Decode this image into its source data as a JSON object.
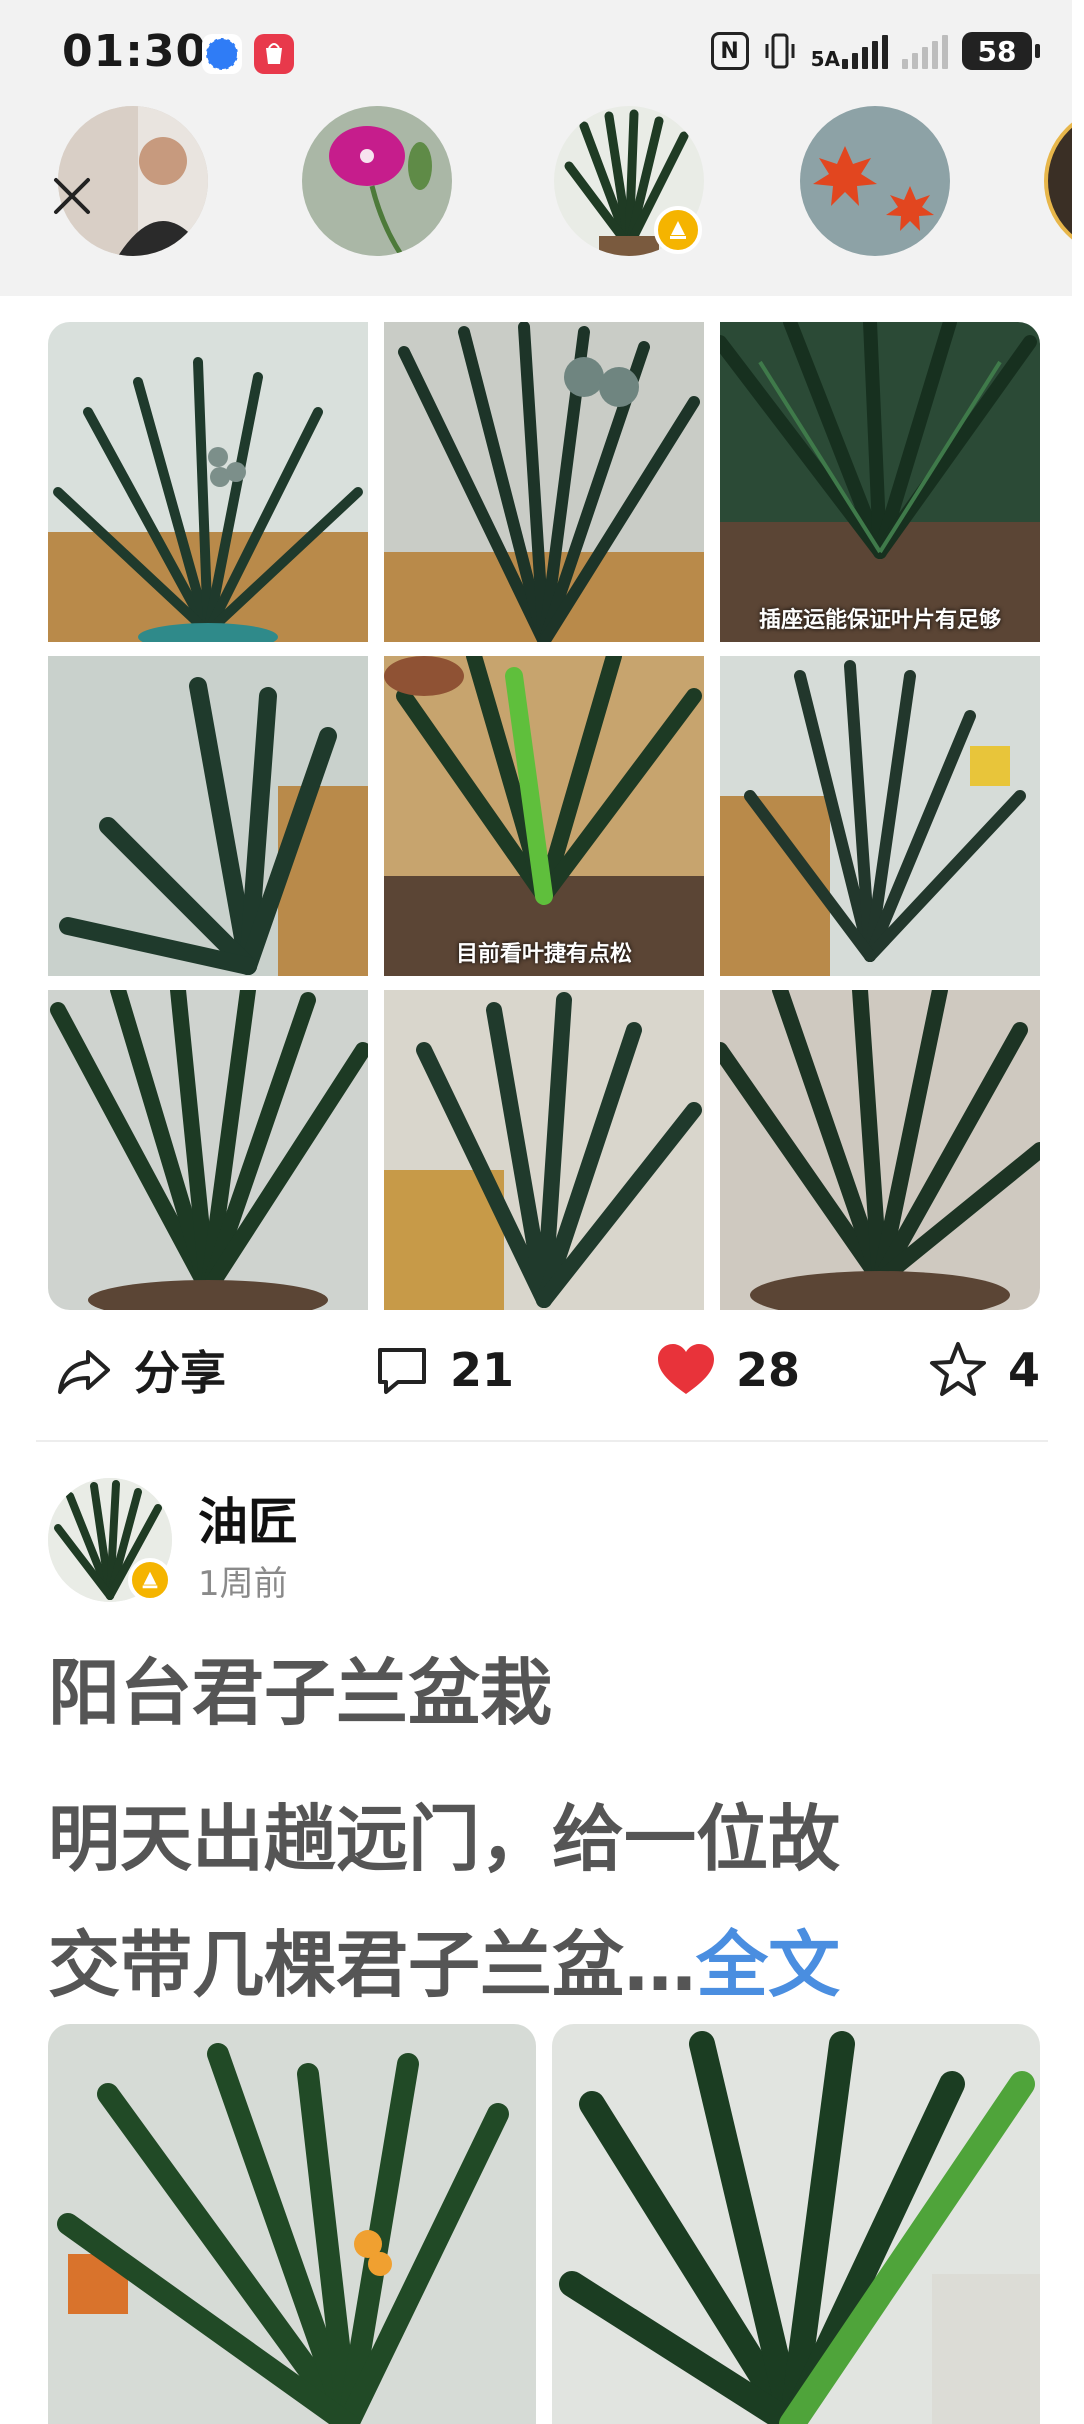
{
  "status_bar": {
    "time": "01:30",
    "network_label": "5A",
    "battery": "58",
    "nfc_label": "N",
    "app_gallery_label": "App Gallery"
  },
  "stories": {
    "items": [
      {
        "name": "story-portrait",
        "active": false
      },
      {
        "name": "story-pink-flower",
        "active": false
      },
      {
        "name": "story-clivia",
        "active": true
      },
      {
        "name": "story-maple",
        "active": false
      }
    ]
  },
  "gallery": {
    "captions": [
      "",
      "",
      "插座运能保证叶片有足够",
      "",
      "目前看叶捷有点松",
      "",
      "",
      "",
      ""
    ]
  },
  "actions": {
    "share_label": "分享",
    "comments": "21",
    "likes": "28",
    "favorites": "4"
  },
  "post": {
    "author": "油匠",
    "time_ago": "1周前",
    "title": "阳台君子兰盆栽",
    "body_line1": "明天出趟远门，给一位故",
    "body_line2": "交带几棵君子兰盆…",
    "more_label": "全文"
  },
  "colors": {
    "like_red": "#e8333a",
    "link_blue": "#4a8ee0",
    "badge_yellow": "#f5b400"
  }
}
